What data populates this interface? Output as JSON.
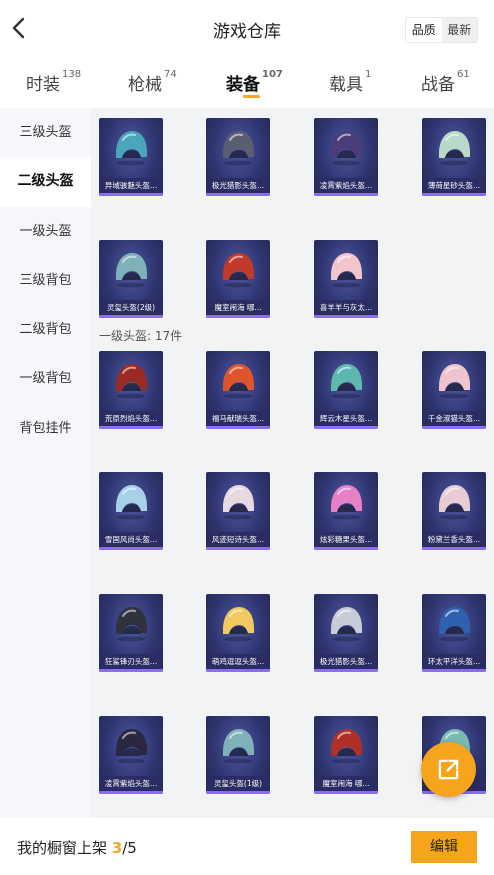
{
  "header": {
    "title": "游戏仓库",
    "sort_options": [
      "品质",
      "最新"
    ],
    "sort_active": "品质"
  },
  "tabs": [
    {
      "label": "时装",
      "count": "138"
    },
    {
      "label": "枪械",
      "count": "74"
    },
    {
      "label": "装备",
      "count": "107",
      "active": true
    },
    {
      "label": "载具",
      "count": "1"
    },
    {
      "label": "战备",
      "count": "61"
    }
  ],
  "sidebar": {
    "items": [
      "三级头盔",
      "二级头盔",
      "一级头盔",
      "三级背包",
      "二级背包",
      "一级背包",
      "背包挂件"
    ],
    "active": "二级头盔"
  },
  "grid": {
    "section_level1_label": "一级头盔: 17件",
    "items": [
      {
        "name": "异域骇魅头盔...",
        "icon": "helmet-icon",
        "color": "#4aa6b8"
      },
      {
        "name": "极光猎影头盔...",
        "icon": "helmet-icon",
        "color": "#5a5e70"
      },
      {
        "name": "凌霄紫焰头盔...",
        "icon": "helmet-icon",
        "color": "#4b3d78"
      },
      {
        "name": "薄荷星砂头盔...",
        "icon": "helmet-icon",
        "color": "#b8d8c8"
      },
      {
        "name": "灵玺头盔(2级)",
        "icon": "helmet-icon",
        "color": "#7fb2b8"
      },
      {
        "name": "魔室闹海 哪...",
        "icon": "helmet-icon",
        "color": "#c0392b"
      },
      {
        "name": "喜羊羊与灰太...",
        "icon": "helmet-icon",
        "color": "#f2c4cc"
      },
      {
        "name": "荒原烈焰头盔...",
        "icon": "helmet-icon",
        "color": "#9a2a24"
      },
      {
        "name": "福马献瑞头盔...",
        "icon": "helmet-icon",
        "color": "#e0542c"
      },
      {
        "name": "辉云木星头盔...",
        "icon": "helmet-icon",
        "color": "#5fb8b0"
      },
      {
        "name": "千金淑猫头盔...",
        "icon": "helmet-icon",
        "color": "#f0c4cc"
      },
      {
        "name": "雪国风尚头盔...",
        "icon": "helmet-icon",
        "color": "#a8d0e8"
      },
      {
        "name": "风迹短诗头盔...",
        "icon": "helmet-icon",
        "color": "#e8d8e0"
      },
      {
        "name": "炫彩糖果头盔...",
        "icon": "helmet-icon",
        "color": "#e880c8"
      },
      {
        "name": "粉黛兰香头盔...",
        "icon": "helmet-icon",
        "color": "#e8ccd4"
      },
      {
        "name": "狂鲨锋刃头盔...",
        "icon": "helmet-icon",
        "color": "#303240"
      },
      {
        "name": "萌鸡逗逗头盔...",
        "icon": "helmet-icon",
        "color": "#f2c860"
      },
      {
        "name": "极光猎影头盔...",
        "icon": "helmet-icon",
        "color": "#c8ccd8"
      },
      {
        "name": "环太平洋头盔...",
        "icon": "helmet-icon",
        "color": "#3060b0"
      },
      {
        "name": "凌霄紫焰头盔...",
        "icon": "helmet-icon",
        "color": "#2a2840"
      },
      {
        "name": "灵玺头盔(1级)",
        "icon": "helmet-icon",
        "color": "#7fb2b8"
      },
      {
        "name": "魔室闹海 哪...",
        "icon": "helmet-icon",
        "color": "#b03028"
      },
      {
        "name": "",
        "icon": "helmet-icon",
        "color": "#7abab0"
      }
    ]
  },
  "fab": {
    "icon": "share-icon",
    "accent": "#f6a41c"
  },
  "bottom": {
    "showcase_label": "我的橱窗上架",
    "showcase_current": "3",
    "showcase_total": "/5",
    "edit_label": "编辑"
  }
}
